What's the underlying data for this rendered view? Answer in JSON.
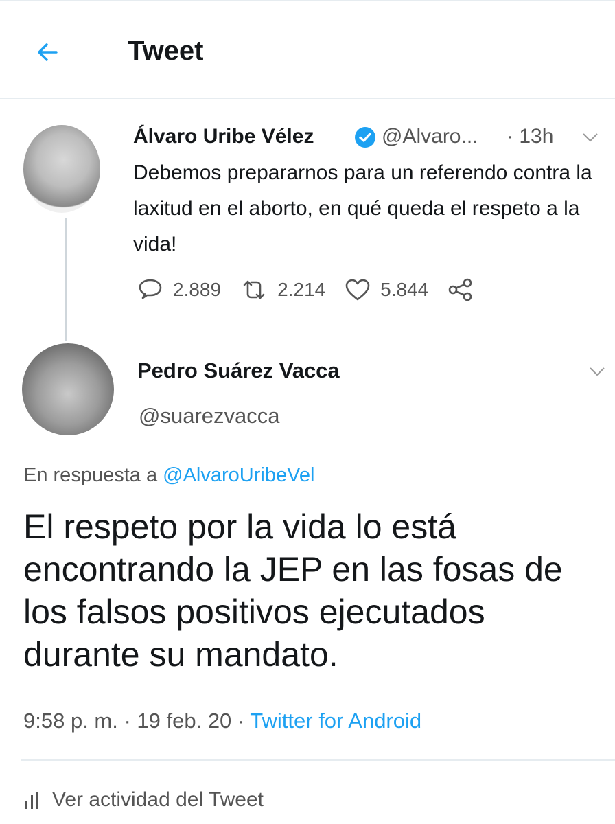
{
  "header": {
    "title": "Tweet"
  },
  "colors": {
    "accent": "#1da1f2",
    "text": "#14171a",
    "muted": "#555555"
  },
  "parent_tweet": {
    "author_name": "Álvaro Uribe Vélez",
    "handle": "@Alvaro...",
    "time": "· 13h",
    "text": "Debemos prepararnos para un referendo contra la laxitud en el aborto, en qué queda el respeto a la vida!",
    "replies": "2.889",
    "retweets": "2.214",
    "likes": "5.844",
    "icons": [
      "reply-icon",
      "retweet-icon",
      "like-icon",
      "share-icon",
      "verified-badge-icon",
      "chevron-down-icon"
    ]
  },
  "reply_tweet": {
    "author_name": "Pedro Suárez Vacca",
    "handle": "@suarezvacca",
    "in_reply_prefix": "En respuesta a",
    "in_reply_mention": "@AlvaroUribeVel",
    "text": "El respeto por la vida lo está encontrando la JEP en las fosas de los falsos positivos ejecutados durante su mandato.",
    "timestamp": "9:58 p. m. · 19 feb. 20 ·",
    "source": "Twitter for Android",
    "activity_label": "Ver actividad del Tweet"
  }
}
